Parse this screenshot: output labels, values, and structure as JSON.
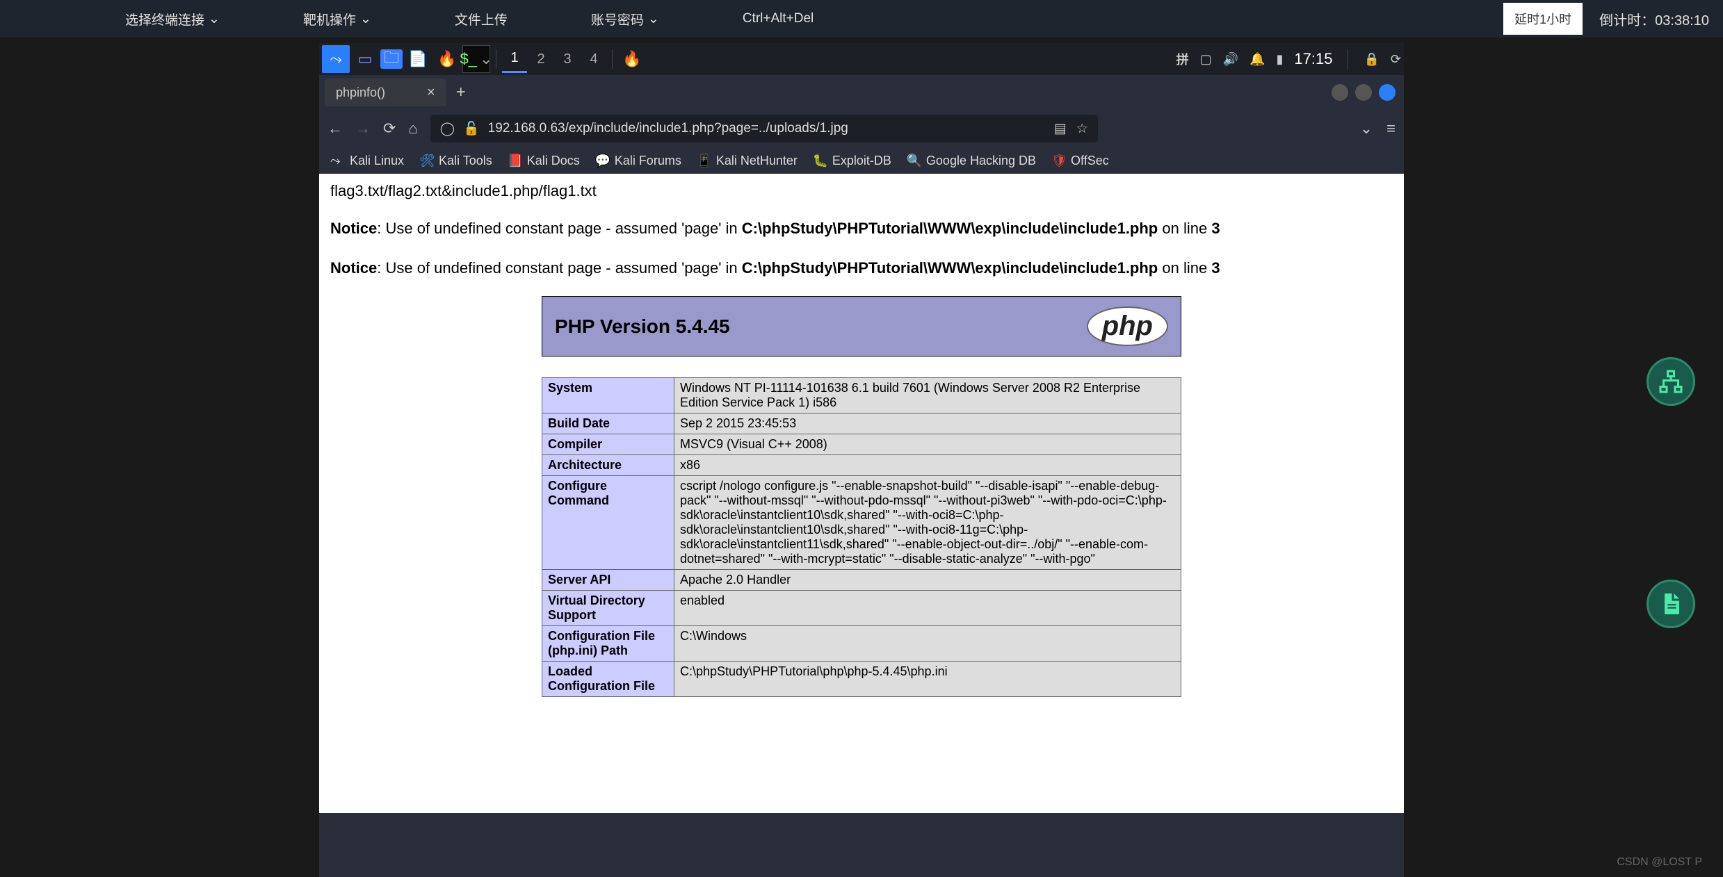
{
  "top_menu": {
    "connection": "选择终端连接",
    "target": "靶机操作",
    "upload": "文件上传",
    "credentials": "账号密码",
    "cad": "Ctrl+Alt+Del"
  },
  "top_right": {
    "delay_btn": "延时1小时",
    "countdown_label": "倒计时：",
    "countdown_value": "03:38:10"
  },
  "taskbar": {
    "workspaces": [
      "1",
      "2",
      "3",
      "4"
    ],
    "active_workspace": 0,
    "ime": "拼",
    "time": "17:15"
  },
  "browser": {
    "tab_title": "phpinfo()",
    "url": "192.168.0.63/exp/include/include1.php?page=../uploads/1.jpg",
    "bookmarks": [
      {
        "icon": "kali",
        "label": "Kali Linux"
      },
      {
        "icon": "tools",
        "label": "Kali Tools"
      },
      {
        "icon": "docs",
        "label": "Kali Docs"
      },
      {
        "icon": "forums",
        "label": "Kali Forums"
      },
      {
        "icon": "nethunter",
        "label": "Kali NetHunter"
      },
      {
        "icon": "exploit",
        "label": "Exploit-DB"
      },
      {
        "icon": "ghdb",
        "label": "Google Hacking DB"
      },
      {
        "icon": "offsec",
        "label": "OffSec"
      }
    ]
  },
  "page": {
    "flag_line": "flag3.txt/flag2.txt&include1.php/flag1.txt",
    "notice_label": "Notice",
    "notice_text": ": Use of undefined constant page - assumed 'page' in ",
    "notice_path": "C:\\phpStudy\\PHPTutorial\\WWW\\exp\\include\\include1.php",
    "notice_online": " on line ",
    "notice_line": "3",
    "php_version_title": "PHP Version 5.4.45",
    "phpinfo_rows": [
      {
        "k": "System",
        "v": "Windows NT PI-11114-101638 6.1 build 7601 (Windows Server 2008 R2 Enterprise Edition Service Pack 1) i586"
      },
      {
        "k": "Build Date",
        "v": "Sep 2 2015 23:45:53"
      },
      {
        "k": "Compiler",
        "v": "MSVC9 (Visual C++ 2008)"
      },
      {
        "k": "Architecture",
        "v": "x86"
      },
      {
        "k": "Configure Command",
        "v": "cscript /nologo configure.js \"--enable-snapshot-build\" \"--disable-isapi\" \"--enable-debug-pack\" \"--without-mssql\" \"--without-pdo-mssql\" \"--without-pi3web\" \"--with-pdo-oci=C:\\php-sdk\\oracle\\instantclient10\\sdk,shared\" \"--with-oci8=C:\\php-sdk\\oracle\\instantclient10\\sdk,shared\" \"--with-oci8-11g=C:\\php-sdk\\oracle\\instantclient11\\sdk,shared\" \"--enable-object-out-dir=../obj/\" \"--enable-com-dotnet=shared\" \"--with-mcrypt=static\" \"--disable-static-analyze\" \"--with-pgo\""
      },
      {
        "k": "Server API",
        "v": "Apache 2.0 Handler"
      },
      {
        "k": "Virtual Directory Support",
        "v": "enabled"
      },
      {
        "k": "Configuration File (php.ini) Path",
        "v": "C:\\Windows"
      },
      {
        "k": "Loaded Configuration File",
        "v": "C:\\phpStudy\\PHPTutorial\\php\\php-5.4.45\\php.ini"
      }
    ]
  },
  "watermark": "CSDN @LOST P"
}
